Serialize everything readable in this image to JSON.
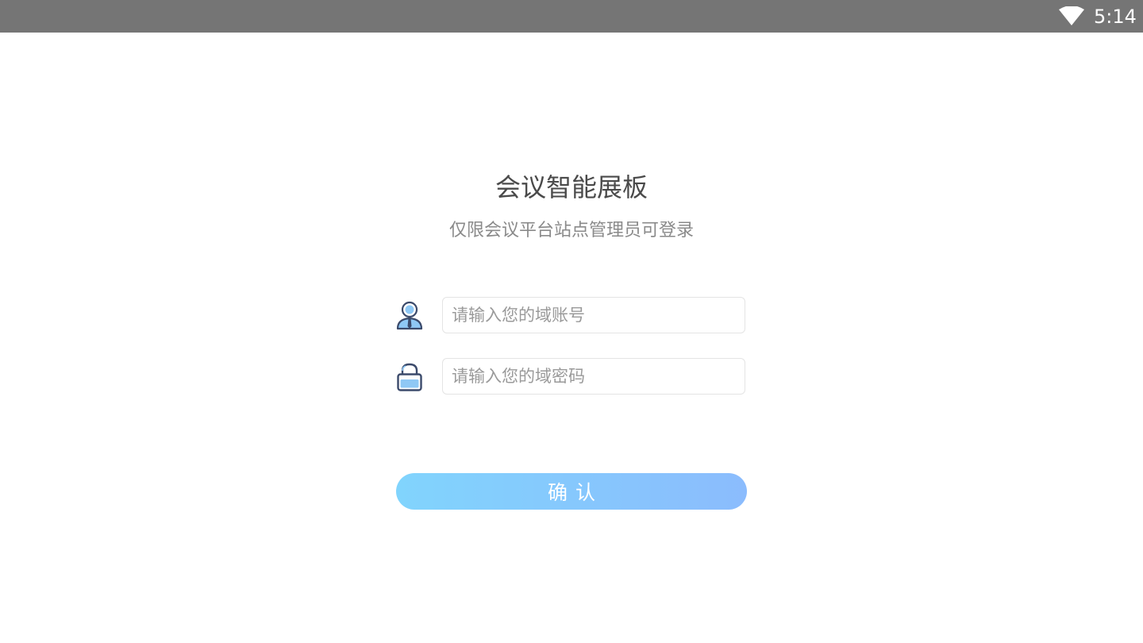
{
  "status_bar": {
    "time": "5:14",
    "wifi_icon": "wifi-icon"
  },
  "login": {
    "title": "会议智能展板",
    "subtitle": "仅限会议平台站点管理员可登录",
    "username": {
      "icon": "user-icon",
      "placeholder": "请输入您的域账号",
      "value": ""
    },
    "password": {
      "icon": "lock-icon",
      "placeholder": "请输入您的域密码",
      "value": ""
    },
    "confirm_label": "确认"
  },
  "colors": {
    "status_bar": "#757575",
    "button_gradient_start": "#81d4fd",
    "button_gradient_end": "#8bbcfd",
    "icon_dark": "#3b4a6b",
    "icon_light": "#8fc8f5"
  }
}
